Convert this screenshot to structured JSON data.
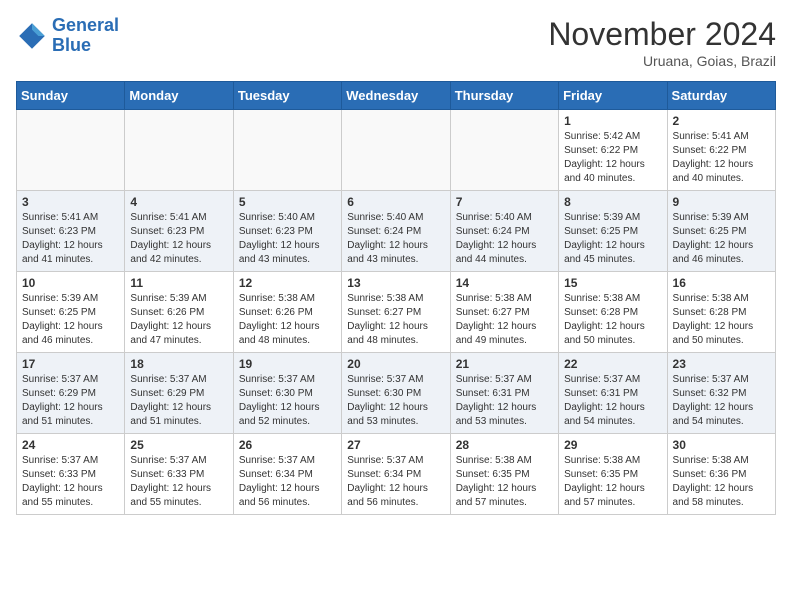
{
  "header": {
    "logo_line1": "General",
    "logo_line2": "Blue",
    "month": "November 2024",
    "location": "Uruana, Goias, Brazil"
  },
  "weekdays": [
    "Sunday",
    "Monday",
    "Tuesday",
    "Wednesday",
    "Thursday",
    "Friday",
    "Saturday"
  ],
  "weeks": [
    [
      {
        "day": "",
        "info": ""
      },
      {
        "day": "",
        "info": ""
      },
      {
        "day": "",
        "info": ""
      },
      {
        "day": "",
        "info": ""
      },
      {
        "day": "",
        "info": ""
      },
      {
        "day": "1",
        "info": "Sunrise: 5:42 AM\nSunset: 6:22 PM\nDaylight: 12 hours\nand 40 minutes."
      },
      {
        "day": "2",
        "info": "Sunrise: 5:41 AM\nSunset: 6:22 PM\nDaylight: 12 hours\nand 40 minutes."
      }
    ],
    [
      {
        "day": "3",
        "info": "Sunrise: 5:41 AM\nSunset: 6:23 PM\nDaylight: 12 hours\nand 41 minutes."
      },
      {
        "day": "4",
        "info": "Sunrise: 5:41 AM\nSunset: 6:23 PM\nDaylight: 12 hours\nand 42 minutes."
      },
      {
        "day": "5",
        "info": "Sunrise: 5:40 AM\nSunset: 6:23 PM\nDaylight: 12 hours\nand 43 minutes."
      },
      {
        "day": "6",
        "info": "Sunrise: 5:40 AM\nSunset: 6:24 PM\nDaylight: 12 hours\nand 43 minutes."
      },
      {
        "day": "7",
        "info": "Sunrise: 5:40 AM\nSunset: 6:24 PM\nDaylight: 12 hours\nand 44 minutes."
      },
      {
        "day": "8",
        "info": "Sunrise: 5:39 AM\nSunset: 6:25 PM\nDaylight: 12 hours\nand 45 minutes."
      },
      {
        "day": "9",
        "info": "Sunrise: 5:39 AM\nSunset: 6:25 PM\nDaylight: 12 hours\nand 46 minutes."
      }
    ],
    [
      {
        "day": "10",
        "info": "Sunrise: 5:39 AM\nSunset: 6:25 PM\nDaylight: 12 hours\nand 46 minutes."
      },
      {
        "day": "11",
        "info": "Sunrise: 5:39 AM\nSunset: 6:26 PM\nDaylight: 12 hours\nand 47 minutes."
      },
      {
        "day": "12",
        "info": "Sunrise: 5:38 AM\nSunset: 6:26 PM\nDaylight: 12 hours\nand 48 minutes."
      },
      {
        "day": "13",
        "info": "Sunrise: 5:38 AM\nSunset: 6:27 PM\nDaylight: 12 hours\nand 48 minutes."
      },
      {
        "day": "14",
        "info": "Sunrise: 5:38 AM\nSunset: 6:27 PM\nDaylight: 12 hours\nand 49 minutes."
      },
      {
        "day": "15",
        "info": "Sunrise: 5:38 AM\nSunset: 6:28 PM\nDaylight: 12 hours\nand 50 minutes."
      },
      {
        "day": "16",
        "info": "Sunrise: 5:38 AM\nSunset: 6:28 PM\nDaylight: 12 hours\nand 50 minutes."
      }
    ],
    [
      {
        "day": "17",
        "info": "Sunrise: 5:37 AM\nSunset: 6:29 PM\nDaylight: 12 hours\nand 51 minutes."
      },
      {
        "day": "18",
        "info": "Sunrise: 5:37 AM\nSunset: 6:29 PM\nDaylight: 12 hours\nand 51 minutes."
      },
      {
        "day": "19",
        "info": "Sunrise: 5:37 AM\nSunset: 6:30 PM\nDaylight: 12 hours\nand 52 minutes."
      },
      {
        "day": "20",
        "info": "Sunrise: 5:37 AM\nSunset: 6:30 PM\nDaylight: 12 hours\nand 53 minutes."
      },
      {
        "day": "21",
        "info": "Sunrise: 5:37 AM\nSunset: 6:31 PM\nDaylight: 12 hours\nand 53 minutes."
      },
      {
        "day": "22",
        "info": "Sunrise: 5:37 AM\nSunset: 6:31 PM\nDaylight: 12 hours\nand 54 minutes."
      },
      {
        "day": "23",
        "info": "Sunrise: 5:37 AM\nSunset: 6:32 PM\nDaylight: 12 hours\nand 54 minutes."
      }
    ],
    [
      {
        "day": "24",
        "info": "Sunrise: 5:37 AM\nSunset: 6:33 PM\nDaylight: 12 hours\nand 55 minutes."
      },
      {
        "day": "25",
        "info": "Sunrise: 5:37 AM\nSunset: 6:33 PM\nDaylight: 12 hours\nand 55 minutes."
      },
      {
        "day": "26",
        "info": "Sunrise: 5:37 AM\nSunset: 6:34 PM\nDaylight: 12 hours\nand 56 minutes."
      },
      {
        "day": "27",
        "info": "Sunrise: 5:37 AM\nSunset: 6:34 PM\nDaylight: 12 hours\nand 56 minutes."
      },
      {
        "day": "28",
        "info": "Sunrise: 5:38 AM\nSunset: 6:35 PM\nDaylight: 12 hours\nand 57 minutes."
      },
      {
        "day": "29",
        "info": "Sunrise: 5:38 AM\nSunset: 6:35 PM\nDaylight: 12 hours\nand 57 minutes."
      },
      {
        "day": "30",
        "info": "Sunrise: 5:38 AM\nSunset: 6:36 PM\nDaylight: 12 hours\nand 58 minutes."
      }
    ]
  ]
}
